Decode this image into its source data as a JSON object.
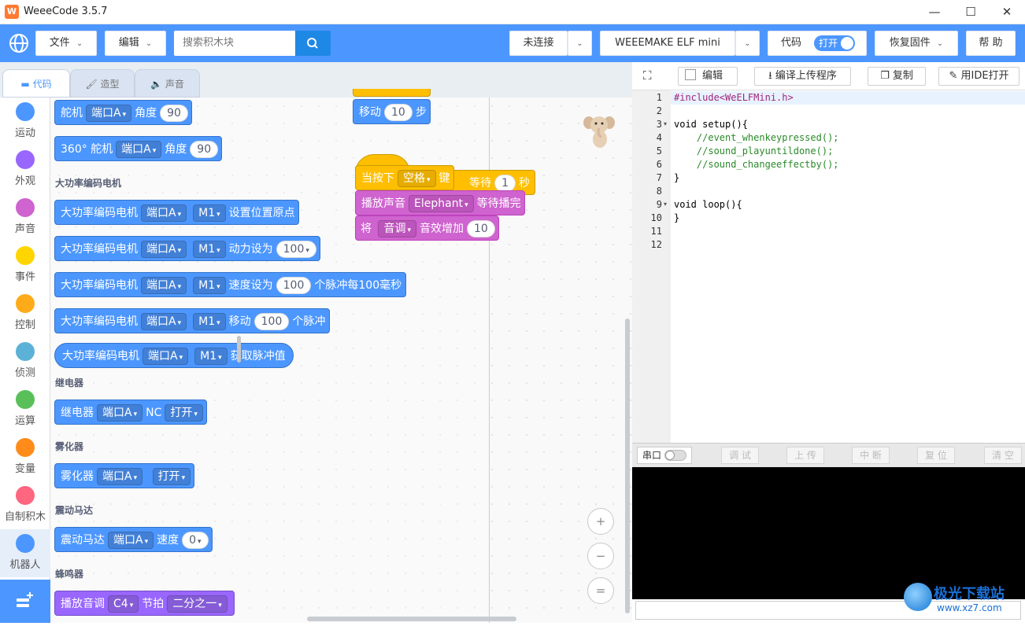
{
  "app": {
    "logo": "W",
    "title": "WeeeCode 3.5.7"
  },
  "window": {
    "minimize": "—",
    "maximize": "☐",
    "close": "✕"
  },
  "topbar": {
    "file": "文件",
    "edit": "编辑",
    "search_placeholder": "搜索积木块",
    "connection": "未连接",
    "device": "WEEEMAKE ELF mini",
    "code_label": "代码",
    "code_toggle": "打开",
    "restore_firmware": "恢复固件",
    "help": "帮 助"
  },
  "tabs": {
    "code": "代码",
    "costume": "造型",
    "sound": "声音"
  },
  "categories": [
    {
      "label": "运动",
      "color": "#4c97ff"
    },
    {
      "label": "外观",
      "color": "#9966ff"
    },
    {
      "label": "声音",
      "color": "#cf63cf"
    },
    {
      "label": "事件",
      "color": "#ffd500"
    },
    {
      "label": "控制",
      "color": "#ffab19"
    },
    {
      "label": "侦测",
      "color": "#5cb1d6"
    },
    {
      "label": "运算",
      "color": "#59c059"
    },
    {
      "label": "变量",
      "color": "#ff8c1a"
    },
    {
      "label": "自制积木",
      "color": "#ff6680"
    },
    {
      "label": "机器人",
      "color": "#4c97ff"
    }
  ],
  "blocks": {
    "servo": {
      "label": "舵机",
      "port": "端口A",
      "angle_label": "角度",
      "angle": "90"
    },
    "servo360": {
      "label": "360° 舵机",
      "port": "端口A",
      "angle_label": "角度",
      "angle": "90"
    },
    "sec_encoder": "大功率编码电机",
    "enc1": {
      "label": "大功率编码电机",
      "port": "端口A",
      "motor": "M1",
      "action": "设置位置原点"
    },
    "enc2": {
      "label": "大功率编码电机",
      "port": "端口A",
      "motor": "M1",
      "action": "动力设为",
      "value": "100"
    },
    "enc3": {
      "label": "大功率编码电机",
      "port": "端口A",
      "motor": "M1",
      "action": "速度设为",
      "value": "100",
      "unit": "个脉冲每100毫秒"
    },
    "enc4": {
      "label": "大功率编码电机",
      "port": "端口A",
      "motor": "M1",
      "action": "移动",
      "value": "100",
      "unit": "个脉冲"
    },
    "enc5": {
      "label": "大功率编码电机",
      "port": "端口A",
      "motor": "M1",
      "action": "获取脉冲值"
    },
    "sec_relay": "继电器",
    "relay": {
      "label": "继电器",
      "port": "端口A",
      "mode": "NC",
      "state": "打开"
    },
    "sec_atomizer": "雾化器",
    "atomizer": {
      "label": "雾化器",
      "port": "端口A",
      "state": "打开"
    },
    "sec_vibration": "震动马达",
    "vibration": {
      "label": "震动马达",
      "port": "端口A",
      "speed_label": "速度",
      "speed": "0"
    },
    "sec_buzzer": "蜂鸣器",
    "buzzer": {
      "label": "播放音调",
      "note": "C4",
      "beat_label": "节拍",
      "beat": "二分之一"
    }
  },
  "script": {
    "move": {
      "label": "移动",
      "value": "10",
      "unit": "步"
    },
    "hat": {
      "label": "当按下",
      "key": "空格",
      "suffix": "键"
    },
    "wait_behind": {
      "label": "等待",
      "value": "1",
      "unit": "秒"
    },
    "play": {
      "label": "播放声音",
      "sound": "Elephant",
      "suffix": "等待播完"
    },
    "effect": {
      "label": "将",
      "effect": "音调",
      "action": "音效增加",
      "value": "10"
    }
  },
  "zoom": {
    "in": "+",
    "out": "−",
    "reset": "="
  },
  "code_toolbar": {
    "fullscreen": "⛶",
    "edit": "编辑",
    "compile_upload": "编译上传程序",
    "copy": "复制",
    "open_ide": "用IDE打开"
  },
  "code_lines": [
    {
      "n": "1",
      "text": "#include<WeELFMini.h>"
    },
    {
      "n": "2",
      "text": ""
    },
    {
      "n": "3",
      "text": "void setup(){"
    },
    {
      "n": "4",
      "text": "    //event_whenkeypressed();"
    },
    {
      "n": "5",
      "text": "    //sound_playuntildone();"
    },
    {
      "n": "6",
      "text": "    //sound_changeeffectby();"
    },
    {
      "n": "7",
      "text": "}"
    },
    {
      "n": "8",
      "text": ""
    },
    {
      "n": "9",
      "text": "void loop(){"
    },
    {
      "n": "10",
      "text": "}"
    },
    {
      "n": "11",
      "text": ""
    },
    {
      "n": "12",
      "text": ""
    }
  ],
  "serial": {
    "toggle_label": "串口",
    "debug": "调 试",
    "upload": "上 传",
    "interrupt": "中 断",
    "reset": "复 位",
    "clear": "清 空"
  },
  "watermark": {
    "site": "极光下载站",
    "url": "www.xz7.com"
  }
}
